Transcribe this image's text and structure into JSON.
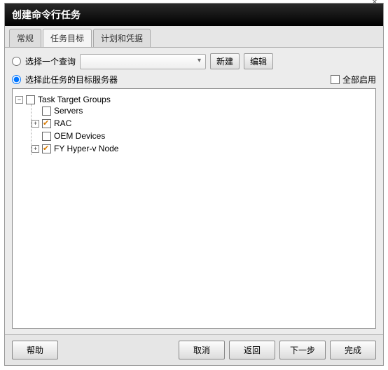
{
  "title": "创建命令行任务",
  "tabs": {
    "general": "常规",
    "target": "任务目标",
    "schedule": "计划和凭据"
  },
  "activeTab": "任务目标",
  "query": {
    "radioLabel": "选择一个查询",
    "newBtn": "新建",
    "editBtn": "编辑"
  },
  "targets": {
    "radioLabel": "选择此任务的目标服务器",
    "selected": true,
    "enableAll": "全部启用"
  },
  "tree": {
    "root": {
      "label": "Task Target Groups",
      "expanded": true,
      "checked": false,
      "children": [
        {
          "label": "Servers",
          "checked": false,
          "expandable": false
        },
        {
          "label": "RAC",
          "checked": true,
          "expandable": true,
          "expanded": false
        },
        {
          "label": "OEM Devices",
          "checked": false,
          "expandable": false
        },
        {
          "label": "FY Hyper-v Node",
          "checked": true,
          "expandable": true,
          "expanded": false
        }
      ]
    }
  },
  "footer": {
    "help": "帮助",
    "cancel": "取消",
    "back": "返回",
    "next": "下一步",
    "finish": "完成"
  }
}
